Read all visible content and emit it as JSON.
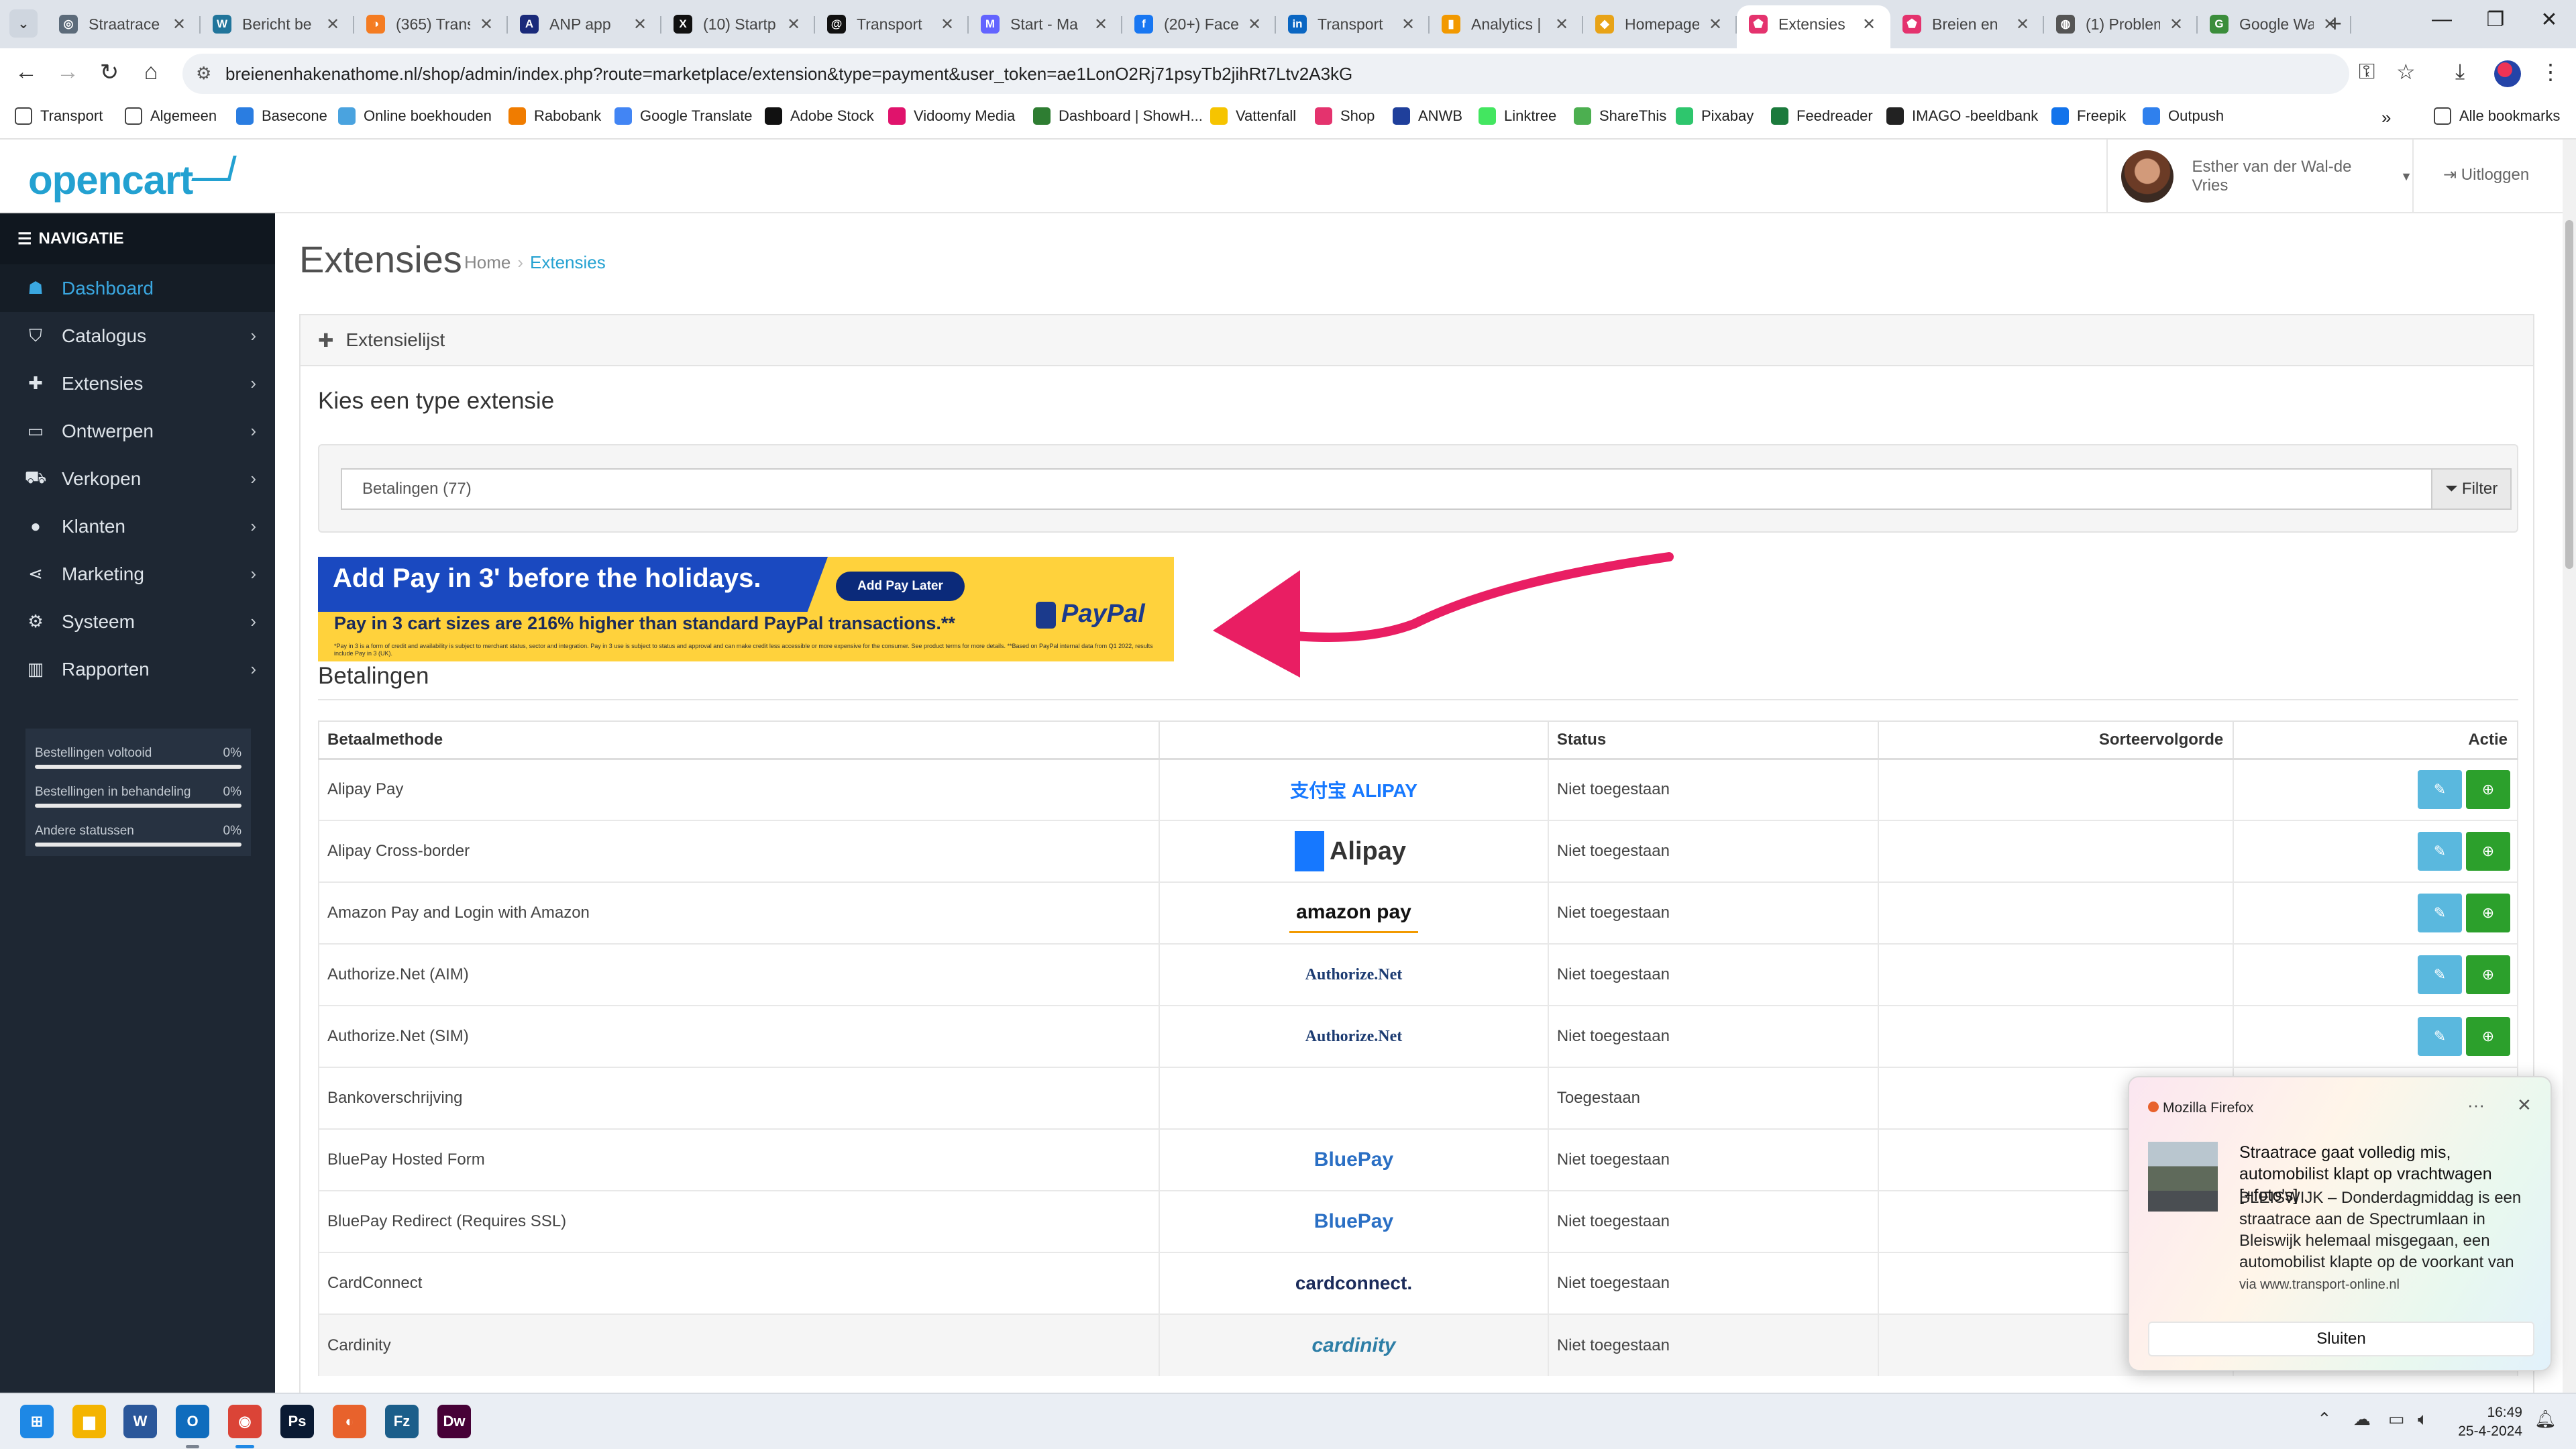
{
  "browser": {
    "tabs": [
      {
        "title": "Straatrace",
        "color": "#5c6b7a",
        "glyph": "◎"
      },
      {
        "title": "Bericht be",
        "color": "#21759b",
        "glyph": "W"
      },
      {
        "title": "(365) Trans",
        "color": "#f47c22",
        "glyph": "◑"
      },
      {
        "title": "ANP app",
        "color": "#1a2a7a",
        "glyph": "A"
      },
      {
        "title": "(10) Startp",
        "color": "#111111",
        "glyph": "X"
      },
      {
        "title": "Transport",
        "color": "#111111",
        "glyph": "@"
      },
      {
        "title": "Start - Ma",
        "color": "#6364ff",
        "glyph": "M"
      },
      {
        "title": "(20+) Face",
        "color": "#1877f2",
        "glyph": "f"
      },
      {
        "title": "Transport",
        "color": "#0a66c2",
        "glyph": "in"
      },
      {
        "title": "Analytics |",
        "color": "#f29900",
        "glyph": "▮"
      },
      {
        "title": "Homepage",
        "color": "#e8a317",
        "glyph": "◆"
      },
      {
        "title": "Extensies",
        "color": "#e4336e",
        "glyph": "⬟",
        "active": true
      },
      {
        "title": "Breien en",
        "color": "#e4336e",
        "glyph": "⬟"
      },
      {
        "title": "(1) Problem",
        "color": "#555555",
        "glyph": "◍"
      },
      {
        "title": "Google Wa",
        "color": "#3b8d3b",
        "glyph": "G"
      }
    ],
    "url": "breienenhakenathome.nl/shop/admin/index.php?route=marketplace/extension&type=payment&user_token=ae1LonO2Rj71psyTb2jihRt7Ltv2A3kG",
    "bookmarks": [
      {
        "label": "Transport",
        "color": "#ffffff"
      },
      {
        "label": "Algemeen",
        "color": "#ffffff"
      },
      {
        "label": "Basecone",
        "color": "#2a7de1"
      },
      {
        "label": "Online boekhouden",
        "color": "#4aa3df"
      },
      {
        "label": "Rabobank",
        "color": "#f07c00"
      },
      {
        "label": "Google Translate",
        "color": "#4285f4"
      },
      {
        "label": "Adobe Stock",
        "color": "#111111"
      },
      {
        "label": "Vidoomy Media",
        "color": "#e0136c"
      },
      {
        "label": "Dashboard | ShowH...",
        "color": "#2e7d32"
      },
      {
        "label": "Vattenfall",
        "color": "#f6c400"
      },
      {
        "label": "Shop",
        "color": "#e4336e"
      },
      {
        "label": "ANWB",
        "color": "#1f3f9b"
      },
      {
        "label": "Linktree",
        "color": "#43e660"
      },
      {
        "label": "ShareThis",
        "color": "#4caf50"
      },
      {
        "label": "Pixabay",
        "color": "#2ec66d"
      },
      {
        "label": "Feedreader",
        "color": "#1b7a3c"
      },
      {
        "label": "IMAGO -beeldbank",
        "color": "#222222"
      },
      {
        "label": "Freepik",
        "color": "#1273eb"
      },
      {
        "label": "Outpush",
        "color": "#2f80ed"
      }
    ],
    "all_bookmarks": "Alle bookmarks"
  },
  "header": {
    "logo": "opencart",
    "user_name": "Esther van der Wal-de Vries",
    "logout": "Uitloggen"
  },
  "sidebar": {
    "heading": "NAVIGATIE",
    "items": [
      {
        "label": "Dashboard",
        "icon": "☗",
        "active": true
      },
      {
        "label": "Catalogus",
        "icon": "⛉"
      },
      {
        "label": "Extensies",
        "icon": "✚"
      },
      {
        "label": "Ontwerpen",
        "icon": "▭"
      },
      {
        "label": "Verkopen",
        "icon": "⛟"
      },
      {
        "label": "Klanten",
        "icon": "●"
      },
      {
        "label": "Marketing",
        "icon": "⋖"
      },
      {
        "label": "Systeem",
        "icon": "⚙"
      },
      {
        "label": "Rapporten",
        "icon": "▥"
      }
    ],
    "stats": [
      {
        "label": "Bestellingen voltooid",
        "value": "0%"
      },
      {
        "label": "Bestellingen in behandeling",
        "value": "0%"
      },
      {
        "label": "Andere statussen",
        "value": "0%"
      }
    ]
  },
  "page": {
    "title": "Extensies",
    "breadcrumb": [
      "Home",
      "Extensies"
    ],
    "panel_title": "Extensielijst",
    "choose_title": "Kies een type extensie",
    "type_select_value": "Betalingen (77)",
    "filter_label": "Filter",
    "section_title": "Betalingen"
  },
  "paypal_banner": {
    "headline": "Add Pay in 3' before the holidays.",
    "cta": "Add Pay Later",
    "sub": "Pay in 3 cart sizes are 216% higher than standard PayPal transactions.**",
    "fine": "*Pay in 3 is a form of credit and availability is subject to merchant status, sector and integration. Pay in 3 use is subject to status and approval and can make credit less accessible or more expensive for the consumer. See product terms for more details. **Based on PayPal internal data from Q1 2022, results include Pay in 3 (UK).",
    "logo": "PayPal"
  },
  "table": {
    "headers": [
      "Betaalmethode",
      "",
      "Status",
      "Sorteervolgorde",
      "Actie"
    ],
    "rows": [
      {
        "name": "Alipay Pay",
        "logo": "支付宝 ALIPAY",
        "status": "Niet toegestaan",
        "order": "",
        "buttons": true
      },
      {
        "name": "Alipay Cross-border",
        "logo": "Alipay",
        "status": "Niet toegestaan",
        "order": "",
        "buttons": true
      },
      {
        "name": "Amazon Pay and Login with Amazon",
        "logo": "amazon pay",
        "status": "Niet toegestaan",
        "order": "",
        "buttons": true
      },
      {
        "name": "Authorize.Net (AIM)",
        "logo": "Authorize.Net",
        "status": "Niet toegestaan",
        "order": "",
        "buttons": true
      },
      {
        "name": "Authorize.Net (SIM)",
        "logo": "Authorize.Net",
        "status": "Niet toegestaan",
        "order": "",
        "buttons": true
      },
      {
        "name": "Bankoverschrijving",
        "logo": "",
        "status": "Toegestaan",
        "order": "",
        "buttons": false
      },
      {
        "name": "BluePay Hosted Form",
        "logo": "BluePay",
        "status": "Niet toegestaan",
        "order": "",
        "buttons": false
      },
      {
        "name": "BluePay Redirect (Requires SSL)",
        "logo": "BluePay",
        "status": "Niet toegestaan",
        "order": "",
        "buttons": false
      },
      {
        "name": "CardConnect",
        "logo": "cardconnect.",
        "status": "Niet toegestaan",
        "order": "",
        "buttons": false
      },
      {
        "name": "Cardinity",
        "logo": "cardinity",
        "status": "Niet toegestaan",
        "order": "",
        "buttons": false
      }
    ]
  },
  "notification": {
    "app": "Mozilla Firefox",
    "title": "Straatrace gaat volledig mis, automobilist klapt op vrachtwagen [+foto's]",
    "body": "BLEISWIJK – Donderdagmiddag is een straatrace aan de Spectrumlaan in Bleiswijk helemaal misgegaan, een automobilist klapte op de voorkant van",
    "source": "via www.transport-online.nl",
    "close_label": "Sluiten"
  },
  "taskbar": {
    "apps": [
      {
        "name": "start",
        "color": "#1e88e5",
        "glyph": "⊞"
      },
      {
        "name": "explorer",
        "color": "#f4b400",
        "glyph": "▆"
      },
      {
        "name": "word",
        "color": "#2b579a",
        "glyph": "W"
      },
      {
        "name": "outlook",
        "color": "#0f6cbd",
        "glyph": "O"
      },
      {
        "name": "chrome",
        "color": "#db4437",
        "glyph": "◉"
      },
      {
        "name": "photoshop",
        "color": "#0a1a33",
        "glyph": "Ps"
      },
      {
        "name": "firefox",
        "color": "#e8622c",
        "glyph": "◐"
      },
      {
        "name": "filezilla",
        "color": "#1b5e8a",
        "glyph": "Fz"
      },
      {
        "name": "dreamweaver",
        "color": "#470137",
        "glyph": "Dw"
      }
    ],
    "time": "16:49",
    "date": "25-4-2024"
  }
}
